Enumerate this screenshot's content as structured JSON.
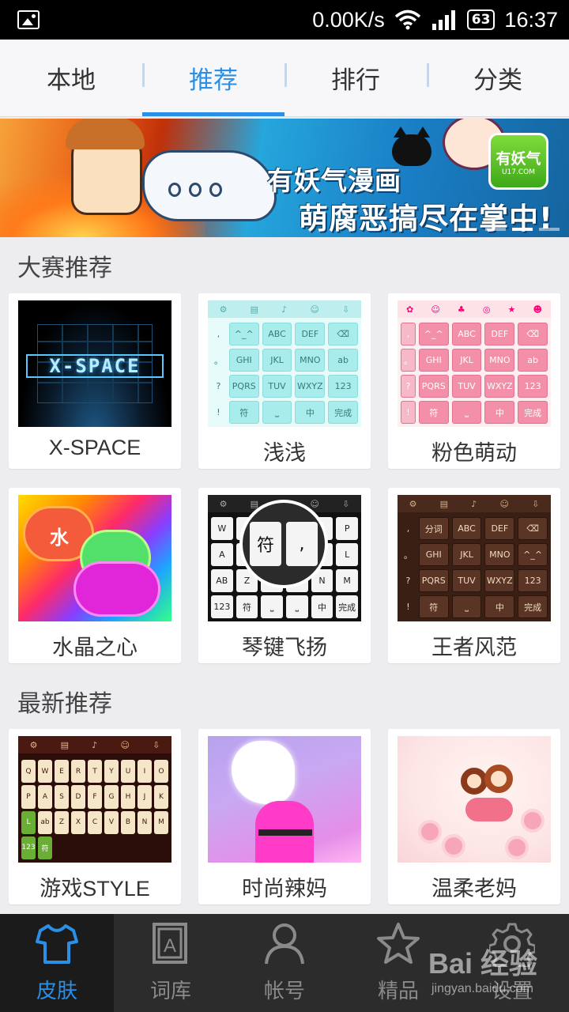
{
  "status_bar": {
    "net_speed": "0.00K/s",
    "battery": "63",
    "time": "16:37",
    "icons": [
      "image-notification-icon",
      "wifi-icon",
      "signal-icon",
      "battery-icon"
    ]
  },
  "top_tabs": [
    {
      "label": "本地",
      "active": false
    },
    {
      "label": "推荐",
      "active": true
    },
    {
      "label": "排行",
      "active": false
    },
    {
      "label": "分类",
      "active": false
    }
  ],
  "banner": {
    "line1": "有妖气漫画",
    "line2": "萌腐恶搞尽在掌中!",
    "badge": "有妖气",
    "badge_sub": "U17.COM"
  },
  "contest_section": {
    "title": "大赛推荐",
    "items": [
      {
        "name": "X-SPACE",
        "thumb_text": "X-SPACE"
      },
      {
        "name": "浅浅"
      },
      {
        "name": "粉色萌动"
      },
      {
        "name": "水晶之心",
        "thumb_text": "水"
      },
      {
        "name": "琴键飞扬",
        "lens_key1": "符",
        "lens_key2": ","
      },
      {
        "name": "王者风范"
      }
    ]
  },
  "keyboard_keys": {
    "row1": [
      "^_^",
      "ABC",
      "DEF"
    ],
    "row2": [
      "GHI",
      "JKL",
      "MNO"
    ],
    "row3": [
      "PQRS",
      "TUV",
      "WXYZ"
    ],
    "row4": [
      "符",
      "中",
      "完成"
    ],
    "side": [
      ",",
      "。",
      "?",
      "!"
    ],
    "extra": [
      "ab",
      "123"
    ],
    "wood_row1": [
      "分词",
      "ABC",
      "DEF"
    ]
  },
  "latest_section": {
    "title": "最新推荐",
    "items": [
      {
        "name": "游戏STYLE"
      },
      {
        "name": "时尚辣妈"
      },
      {
        "name": "温柔老妈"
      }
    ]
  },
  "game_keys": [
    "Q",
    "W",
    "E",
    "R",
    "T",
    "Y",
    "U",
    "I",
    "O",
    "P",
    "A",
    "S",
    "D",
    "F",
    "G",
    "H",
    "J",
    "K",
    "L",
    "ab",
    "Z",
    "X",
    "C",
    "V",
    "B",
    "N",
    "M",
    "123",
    "符"
  ],
  "bottom_nav": [
    {
      "label": "皮肤",
      "icon": "shirt-icon",
      "active": true
    },
    {
      "label": "词库",
      "icon": "dictionary-icon",
      "active": false
    },
    {
      "label": "帐号",
      "icon": "user-icon",
      "active": false
    },
    {
      "label": "精品",
      "icon": "star-icon",
      "active": false
    },
    {
      "label": "设置",
      "icon": "gear-icon",
      "active": false
    }
  ],
  "watermark": {
    "main": "Bai 经验",
    "sub": "jingyan.baidu.com"
  },
  "colors": {
    "accent": "#2a8fe5",
    "nav_bg": "#2c2c2c",
    "page_bg": "#ededf0"
  }
}
